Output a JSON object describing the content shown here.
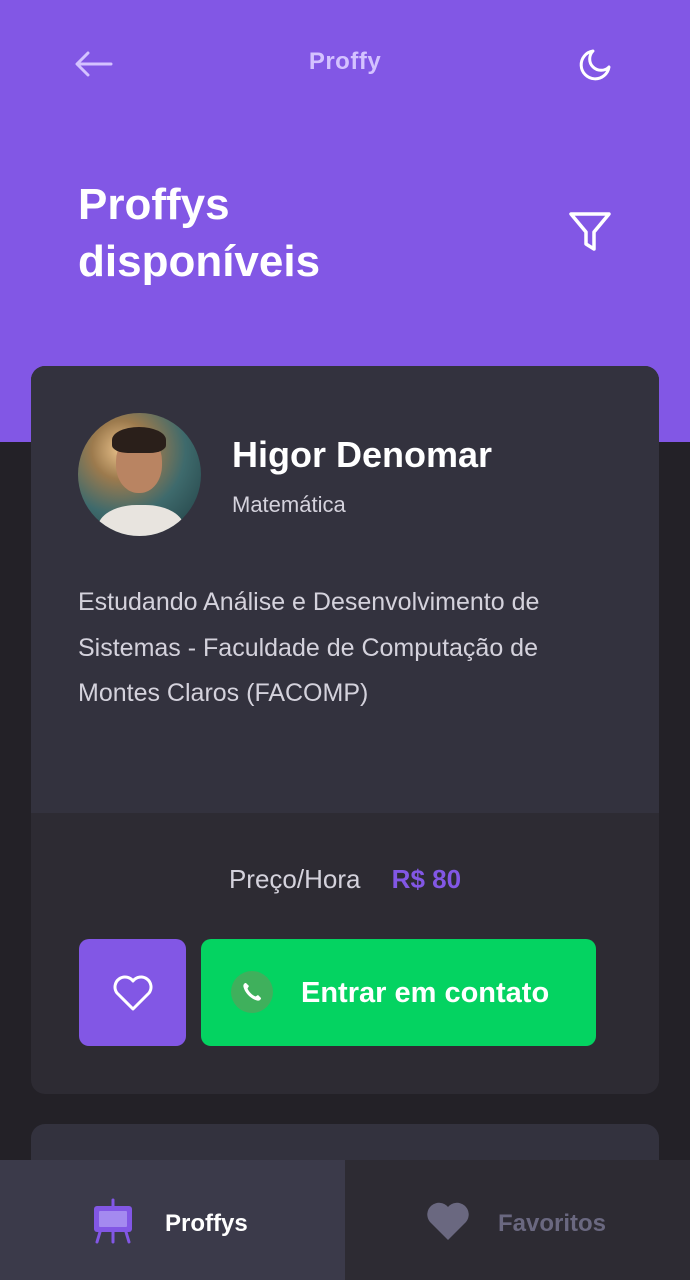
{
  "header": {
    "app_title": "Proffy",
    "page_title": "Proffys disponíveis",
    "back_icon": "arrow-left-icon",
    "theme_icon": "moon-icon",
    "filter_icon": "filter-icon"
  },
  "teacher_card": {
    "name": "Higor Denomar",
    "subject": "Matemática",
    "bio": "Estudando Análise e Desenvolvimento de Sistemas - Faculdade de Computação de Montes Claros (FACOMP)",
    "price_label": "Preço/Hora",
    "price_value": "R$ 80",
    "favorite_icon": "heart-outline-icon",
    "contact_label": "Entrar em contato",
    "contact_icon": "whatsapp-icon"
  },
  "tabbar": {
    "tabs": [
      {
        "label": "Proffys",
        "icon": "easel-icon",
        "active": true
      },
      {
        "label": "Favoritos",
        "icon": "heart-icon",
        "active": false
      }
    ]
  },
  "colors": {
    "primary": "#8257e5",
    "secondary": "#04d361",
    "background": "#232127",
    "card": "#33323e"
  }
}
